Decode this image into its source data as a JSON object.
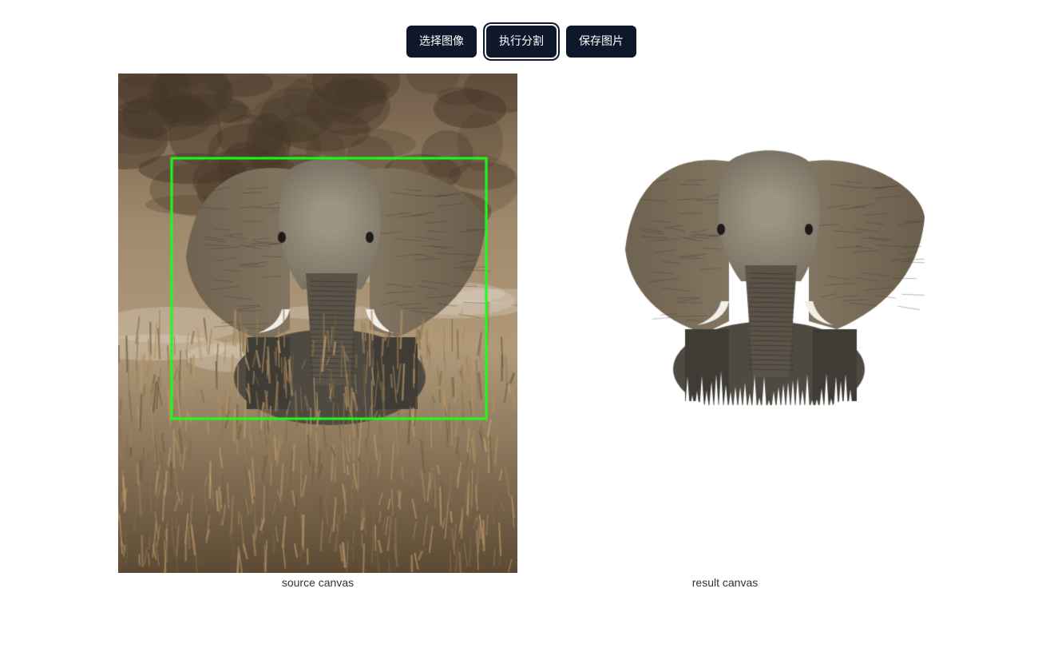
{
  "toolbar": {
    "select_label": "选择图像",
    "segment_label": "执行分割",
    "save_label": "保存图片"
  },
  "source": {
    "caption": "source canvas",
    "box_color": "#1aff1a"
  },
  "result": {
    "caption": "result canvas"
  },
  "colors": {
    "button_bg": "#0f172a",
    "button_text": "#ffffff"
  }
}
